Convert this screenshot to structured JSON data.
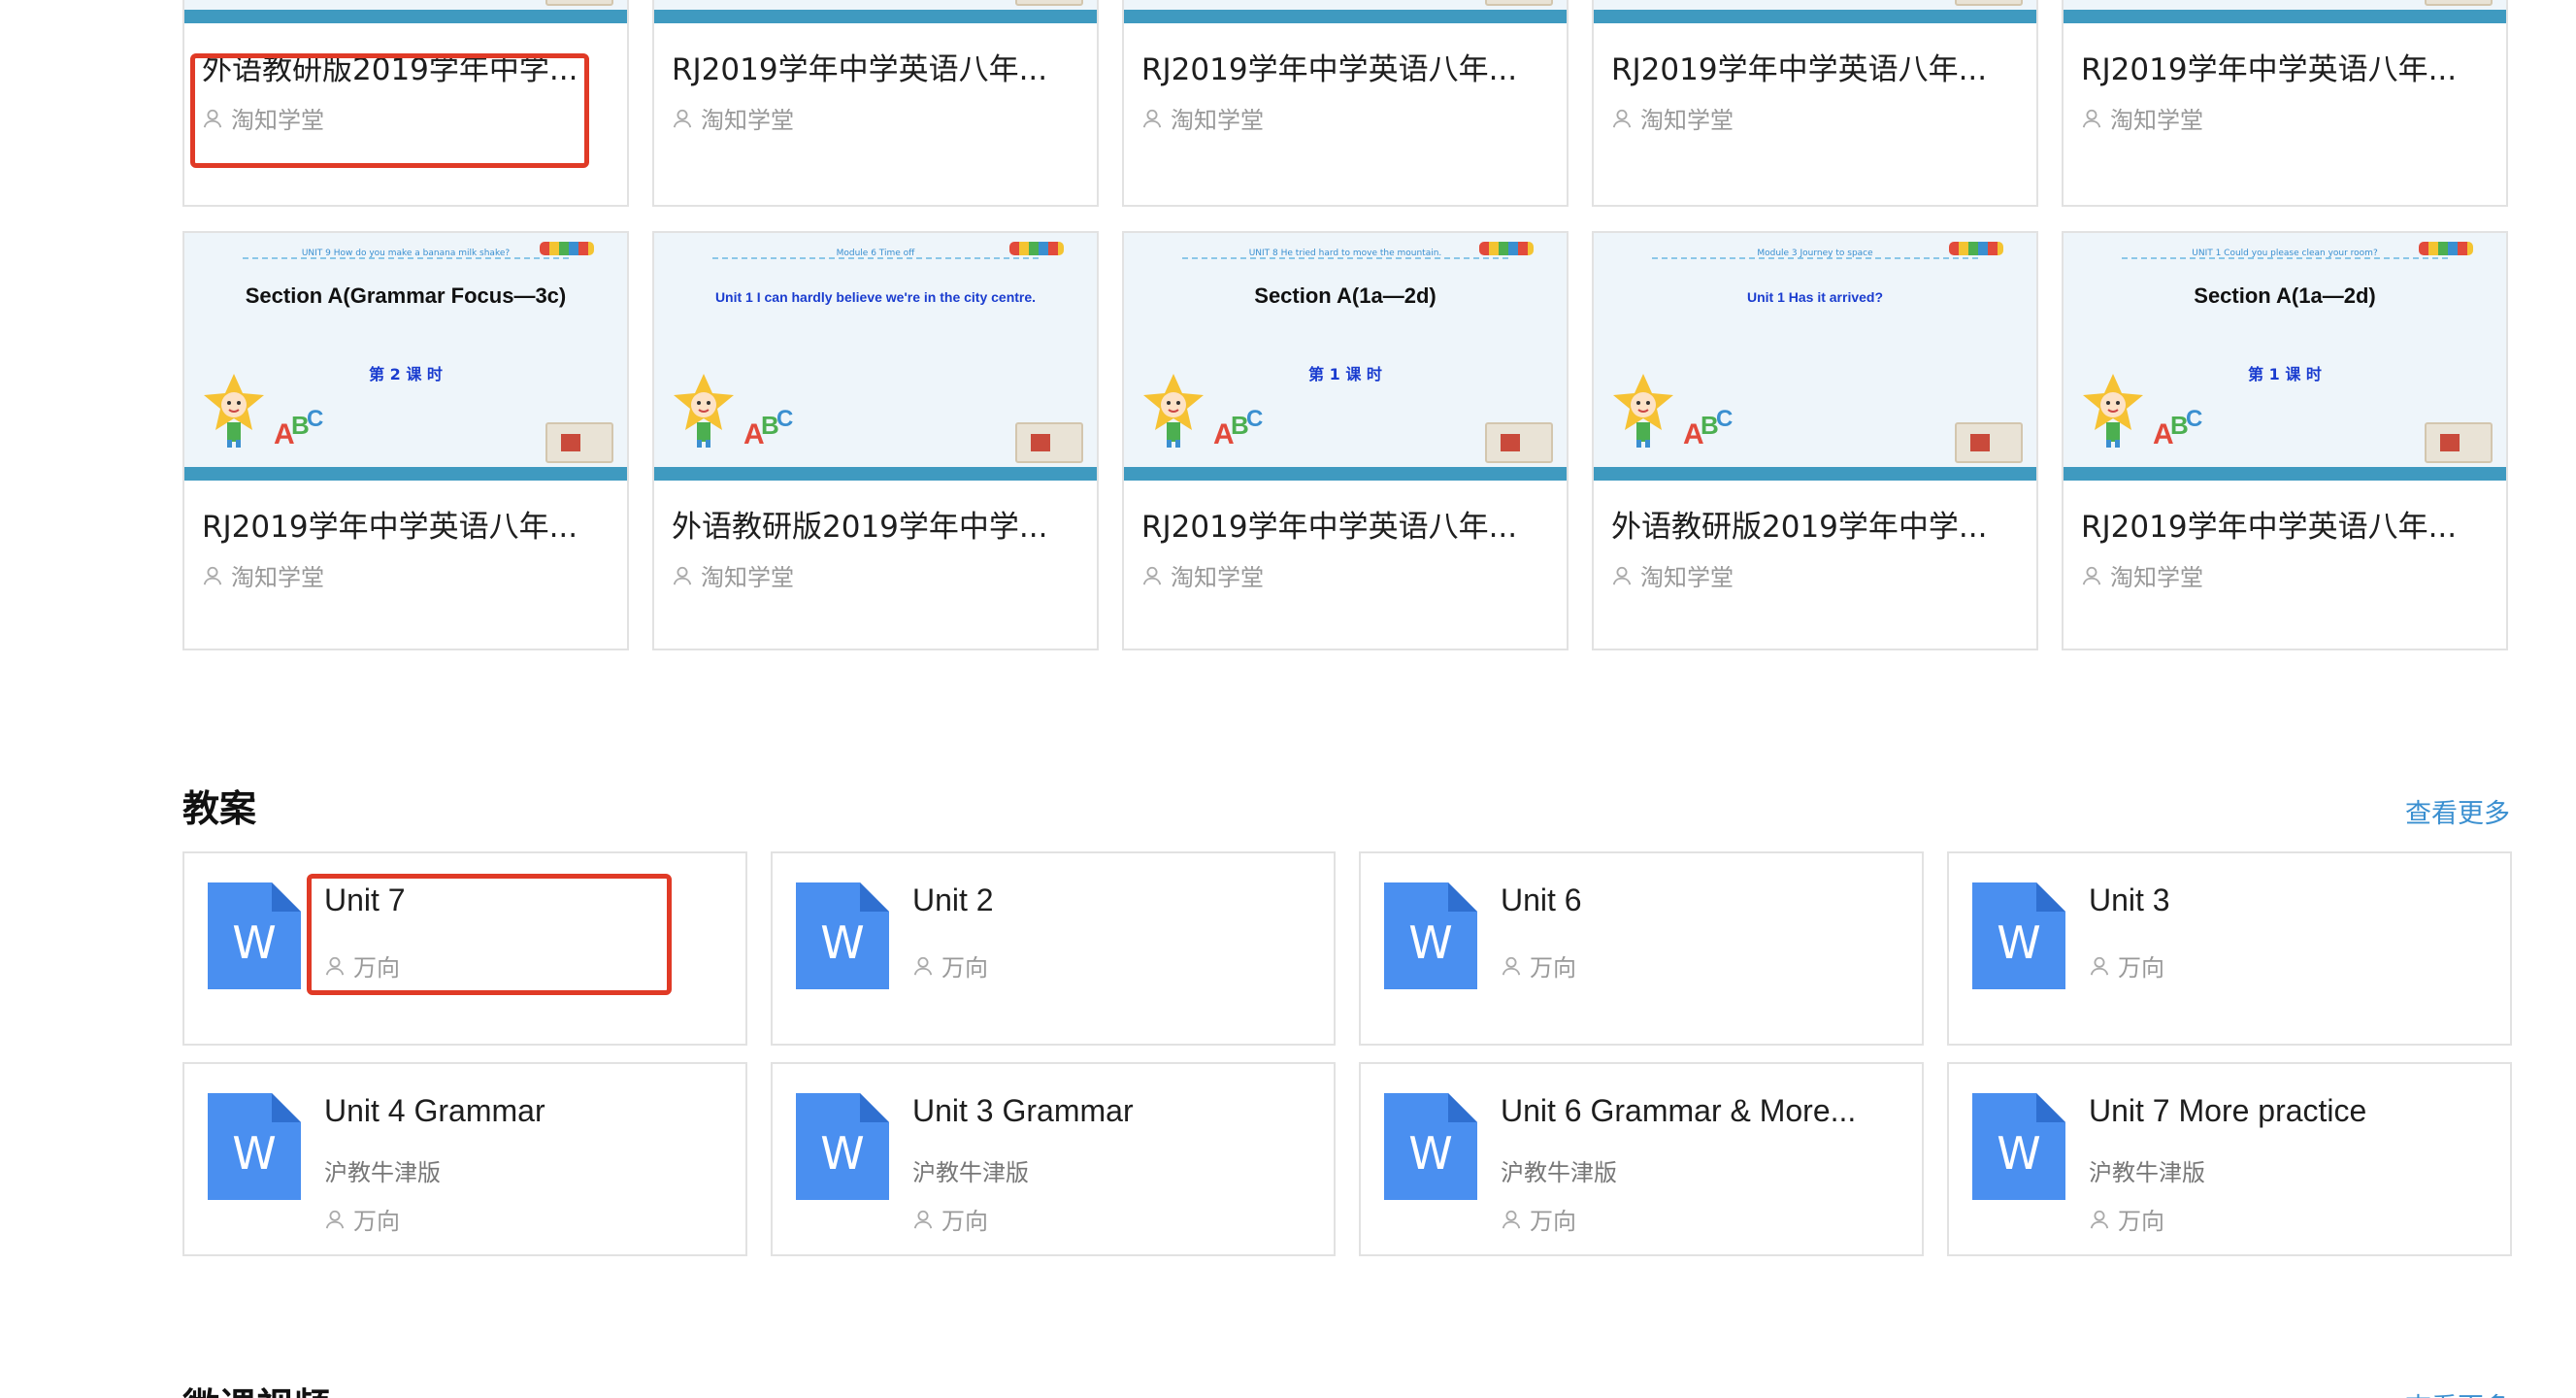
{
  "courses_top": [
    {
      "title": "外语教研版2019学年中学...",
      "author": "淘知学堂"
    },
    {
      "title": "RJ2019学年中学英语八年...",
      "author": "淘知学堂"
    },
    {
      "title": "RJ2019学年中学英语八年...",
      "author": "淘知学堂"
    },
    {
      "title": "RJ2019学年中学英语八年...",
      "author": "淘知学堂"
    },
    {
      "title": "RJ2019学年中学英语八年...",
      "author": "淘知学堂"
    }
  ],
  "courses_bottom": [
    {
      "slide_heading": "Section A(Grammar Focus—3c)",
      "slide_top": "UNIT 9  How do you make a banana milk shake?",
      "lesson": "第 2 课 时",
      "title": "RJ2019学年中学英语八年...",
      "author": "淘知学堂"
    },
    {
      "slide_heading": "Unit 1   I can hardly believe we're in the city centre.",
      "slide_top": "Module 6  Time off",
      "lesson": "",
      "title": "外语教研版2019学年中学...",
      "author": "淘知学堂"
    },
    {
      "slide_heading": "Section A(1a—2d)",
      "slide_top": "UNIT 8  He tried hard to move the mountain.",
      "lesson": "第 1 课 时",
      "title": "RJ2019学年中学英语八年...",
      "author": "淘知学堂"
    },
    {
      "slide_heading": "Unit 1  Has it arrived?",
      "slide_top": "Module 3  Journey to space",
      "lesson": "",
      "title": "外语教研版2019学年中学...",
      "author": "淘知学堂"
    },
    {
      "slide_heading": "Section A(1a—2d)",
      "slide_top": "UNIT 1  Could you please clean your room?",
      "lesson": "第 1 课 时",
      "title": "RJ2019学年中学英语八年...",
      "author": "淘知学堂"
    }
  ],
  "lesson_plans": {
    "section_title": "教案",
    "more_label": "查看更多",
    "row1": [
      {
        "title": "Unit 7",
        "author": "万向"
      },
      {
        "title": "Unit 2",
        "author": "万向"
      },
      {
        "title": "Unit 6",
        "author": "万向"
      },
      {
        "title": "Unit 3",
        "author": "万向"
      }
    ],
    "row2": [
      {
        "title": "Unit 4 Grammar",
        "publisher": "沪教牛津版",
        "author": "万向"
      },
      {
        "title": "Unit 3 Grammar",
        "publisher": "沪教牛津版",
        "author": "万向"
      },
      {
        "title": "Unit 6 Grammar & More...",
        "publisher": "沪教牛津版",
        "author": "万向"
      },
      {
        "title": "Unit 7 More practice",
        "publisher": "沪教牛津版",
        "author": "万向"
      }
    ],
    "doc_icon_letter": "W"
  },
  "next_section": {
    "title": "微课视频",
    "more_label": "查看更多"
  },
  "colors": {
    "accent": "#3a8fd0",
    "highlight": "#e03a26",
    "doc_icon": "#4a8ff0"
  }
}
